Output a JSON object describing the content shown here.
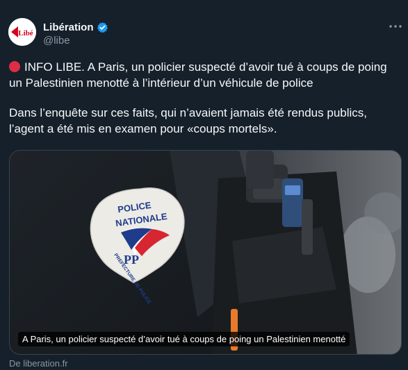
{
  "account": {
    "name": "Libération",
    "handle": "@libe",
    "avatar_text": "Libé"
  },
  "tweet": {
    "paragraph1": "INFO LIBE. A Paris, un policier suspecté d’avoir tué à coups de poing un Palestinien menotté à l’intérieur d’un véhicule de police",
    "paragraph2": "Dans l’enquête sur ces faits, qui n’avaient jamais été rendus publics, l’agent a été mis en examen pour «coups mortels»."
  },
  "media": {
    "caption": "A Paris, un policier suspecté d’avoir tué à coups de poing un Palestinien menotté",
    "patch_line1": "POLICE",
    "patch_line2": "NATIONALE",
    "patch_ring": "PREFECTURE DE POLICE",
    "patch_monogram": "PP"
  },
  "link": {
    "source": "De liberation.fr"
  },
  "colors": {
    "background": "#15202b",
    "text": "#f7f9f9",
    "secondary": "#8b98a5",
    "verified": "#1d9bf0",
    "brand_red": "#d6001c"
  },
  "icons": {
    "verified": "verified-badge-icon",
    "more": "more-options-icon",
    "red_circle": "red-circle-emoji-icon"
  }
}
